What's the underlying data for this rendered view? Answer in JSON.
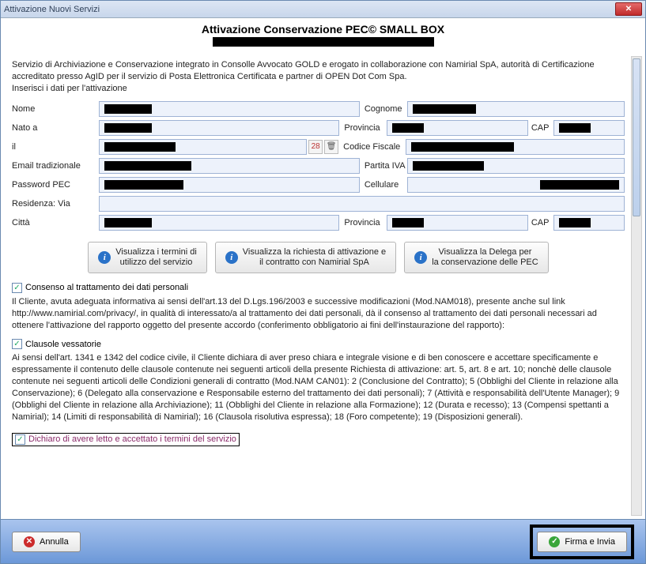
{
  "window": {
    "title": "Attivazione Nuovi Servizi"
  },
  "header": {
    "heading": "Attivazione Conservazione PEC© SMALL BOX"
  },
  "intro": {
    "line1": "Servizio di Archiviazione e Conservazione integrato in Consolle Avvocato GOLD e erogato in collaborazione con Namirial SpA, autorità di Certificazione accreditato presso AgID per il servizio di Posta Elettronica Certificata e partner di OPEN Dot Com Spa.",
    "line2": "Inserisci i dati per l'attivazione"
  },
  "labels": {
    "nome": "Nome",
    "cognome": "Cognome",
    "natoa": "Nato a",
    "provincia": "Provincia",
    "cap": "CAP",
    "il": "il",
    "codfisc": "Codice Fiscale",
    "email": "Email tradizionale",
    "piva": "Partita IVA",
    "pwd": "Password PEC",
    "cellulare": "Cellulare",
    "residenza": "Residenza: Via",
    "citta": "Città"
  },
  "buttons": {
    "terms": {
      "l1": "Visualizza i termini di",
      "l2": "utilizzo del servizio"
    },
    "contract": {
      "l1": "Visualizza la richiesta di attivazione e",
      "l2": "il contratto con Namirial SpA"
    },
    "delega": {
      "l1": "Visualizza la Delega per",
      "l2": "la conservazione delle PEC"
    }
  },
  "consent": {
    "cb1": "Consenso al trattamento dei dati personali",
    "p1": "Il Cliente, avuta adeguata informativa ai sensi dell'art.13 del D.Lgs.196/2003 e successive modificazioni (Mod.NAM018), presente anche sul link http://www.namirial.com/privacy/, in qualità di interessato/a al trattamento dei dati personali, dà il consenso al trattamento dei dati personali necessari ad ottenere l'attivazione del rapporto oggetto del presente accordo (conferimento obbligatorio ai fini dell'instaurazione del rapporto):",
    "cb2": "Clausole vessatorie",
    "p2": "Ai sensi dell'art. 1341 e 1342 del codice civile, il Cliente dichiara di aver preso chiara e integrale visione e di ben conoscere e accettare specificamente e espressamente il contenuto delle clausole contenute nei seguenti articoli della presente Richiesta di attivazione: art. 5, art. 8 e art. 10; nonchè delle clausole contenute nei seguenti articoli delle Condizioni generali di contratto (Mod.NAM CAN01): 2 (Conclusione del Contratto); 5 (Obblighi del Cliente in relazione alla Conservazione); 6 (Delegato alla conservazione e Responsabile esterno del trattamento dei dati personali); 7 (Attività e responsabilità dell'Utente Manager); 9 (Obblighi del Cliente in relazione alla Archiviazione); 11 (Obblighi del Cliente in relazione alla Formazione); 12 (Durata e recesso); 13 (Compensi spettanti a Namirial); 14 (Limiti di responsabilità di Namirial); 16 (Clausola risolutiva espressa); 18 (Foro competente); 19 (Disposizioni generali).",
    "declare": "Dichiaro di avere letto e accettato i termini del servizio"
  },
  "footer": {
    "cancel": "Annulla",
    "submit": "Firma e Invia"
  }
}
